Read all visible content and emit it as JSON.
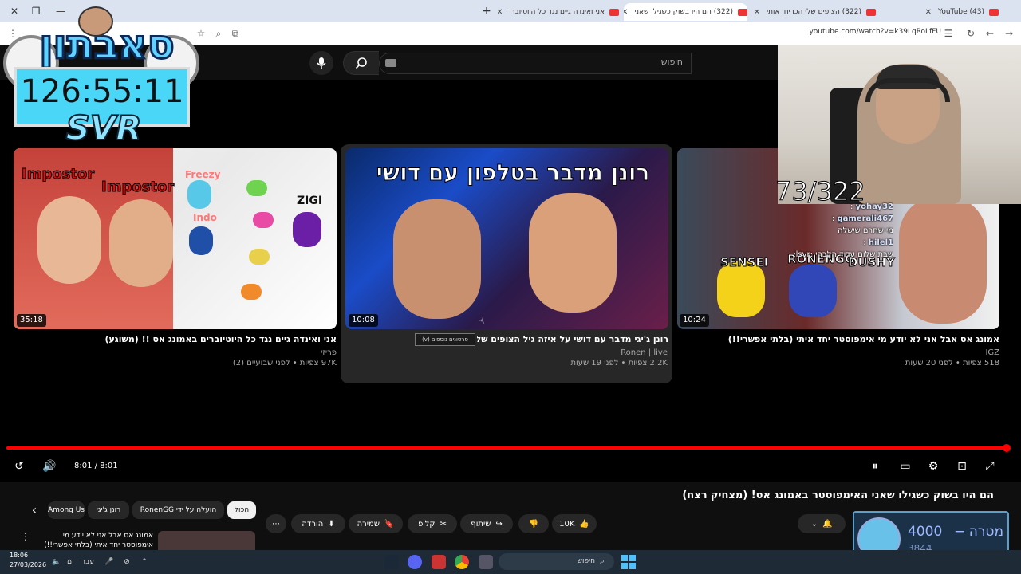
{
  "browser": {
    "tabs": [
      {
        "label": "(43) YouTube"
      },
      {
        "label": "(322) הצופים שלי הכריחו אותי"
      },
      {
        "label": "(322) הם היו בשוק כשגילו שאני",
        "active": true
      },
      {
        "label": "אני ואינדה גיים נגד כל היוטיוברי"
      }
    ],
    "url": "youtube.com/watch?v=k39LqRoLfFU"
  },
  "youtube": {
    "search_placeholder": "חיפוש"
  },
  "overlay": {
    "logo_text": "סאבתון",
    "timer": "126:55:11",
    "timer_sub": "SVR",
    "sub_counter": "73/322"
  },
  "chat": [
    {
      "name": "yohay32",
      "text": ":"
    },
    {
      "name": "gamerali467",
      "text": ":"
    },
    {
      "name": "",
      "text": "מי שתרם שישלה"
    },
    {
      "name": "hilel1",
      "text": ":"
    },
    {
      "name": "",
      "text": "שבת שלום עדוד הלבהי :Lielsvr"
    }
  ],
  "videos": [
    {
      "title": "אני ואינדה גיים נגד כל היוטיוברים באמונג אס !! (משוגע)",
      "channel": "פריזי",
      "meta": "97K צפיות • לפני שבועיים (2)",
      "duration": "35:18"
    },
    {
      "title": "רונן ג'יגי מדבר עם דושי על איזה גיל הצופים שלו! (מצחיק)",
      "channel": "Ronen | live",
      "meta": "2.2K צפיות • לפני 19 שעות",
      "duration": "10:08"
    },
    {
      "title": "אמונג אס אבל אני לא יודע מי אימפוסטר יחד איתי (בלתי אפשרי!!)",
      "channel": "IGZ",
      "meta": "518 צפיות • לפני 20 שעות",
      "duration": "10:24"
    }
  ],
  "thumb_texts": {
    "v1": [
      "Impostor",
      "Impostor",
      "Freezy",
      "Indo",
      "ZIGI"
    ],
    "v2": "רונן מדבר בטלפון עם דושי",
    "v3": [
      "SENSEI",
      "RONENGG",
      "DUSHY"
    ]
  },
  "tooltip": "סרטונים נוספים (v)",
  "player": {
    "time": "8:01 / 8:01",
    "progress": 1.0
  },
  "below": {
    "video_title": "הם היו בשוק כשגילו שאני האימפוסטר באמונג אס! (מצחיק רצח)",
    "likes": "10K",
    "share": "שיתוף",
    "clip": "קליפ",
    "save": "שמירה",
    "download": "הורדה",
    "chips": [
      "הכול",
      "הועלה על ידי RonenGG",
      "רונן ג'יגי",
      "Among Us"
    ]
  },
  "related": {
    "title": "אמונג אס אבל אני לא יודע מי אימפוסטר יחד איתי (בלתי אפשרי!!)"
  },
  "goal": {
    "label": "מטרה",
    "target": "4000",
    "current": "3844",
    "dash": "−"
  },
  "taskbar": {
    "time": "18:06",
    "date": "27/03/2026",
    "lang": "עבר",
    "search": "חיפוש"
  },
  "colors": {
    "accent": "#ff0000",
    "timer_bg": "#4ad6f7"
  }
}
